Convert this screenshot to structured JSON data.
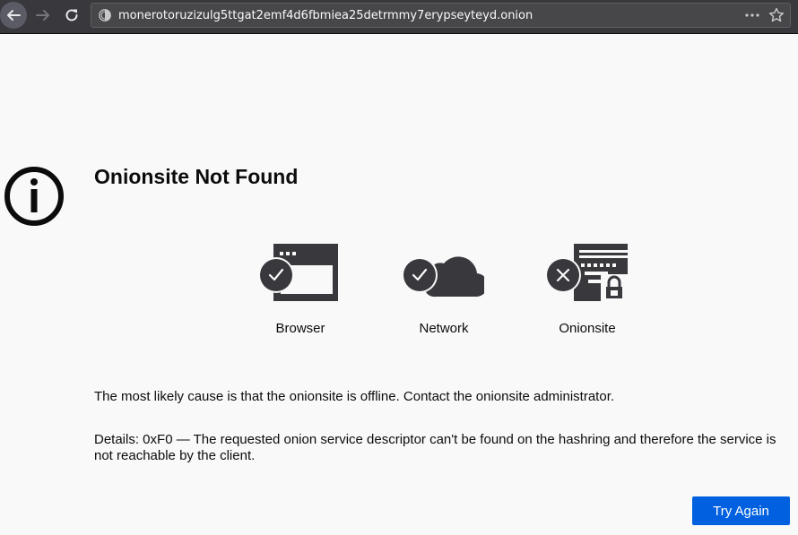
{
  "browser": {
    "url": "monerotoruzizulg5ttgat2emf4d6fbmiea25detrmmy7erypseyteyd.onion",
    "back_icon": "back-arrow-icon",
    "forward_icon": "forward-arrow-icon",
    "reload_icon": "reload-icon",
    "menu_icon": "ellipsis-icon",
    "bookmark_icon": "star-icon"
  },
  "error": {
    "title": "Onionsite Not Found",
    "status_items": [
      {
        "label": "Browser",
        "icon": "browser-window-icon",
        "state": "ok"
      },
      {
        "label": "Network",
        "icon": "cloud-network-icon",
        "state": "ok"
      },
      {
        "label": "Onionsite",
        "icon": "onion-server-icon",
        "state": "error"
      }
    ],
    "cause": "The most likely cause is that the onionsite is offline. Contact the onionsite administrator.",
    "details": "Details: 0xF0 — The requested onion service descriptor can't be found on the hashring and therefore the service is not reachable by the client.",
    "try_again_label": "Try Again"
  },
  "colors": {
    "toolbar": "#38383d",
    "urlbar": "#474749",
    "page_bg": "#f9f9fa",
    "icon_dark": "#38383d",
    "button_blue": "#0060df"
  }
}
